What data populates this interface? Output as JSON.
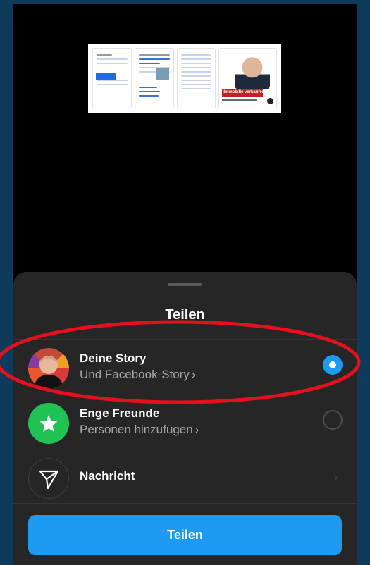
{
  "preview": {
    "ad_headline": "Immobilie verkaufen?"
  },
  "sheet": {
    "title": "Teilen",
    "options": [
      {
        "title": "Deine Story",
        "subtitle": "Und Facebook-Story",
        "selected": true,
        "icon": "avatar"
      },
      {
        "title": "Enge Freunde",
        "subtitle": "Personen hinzufügen",
        "selected": false,
        "icon": "star-icon"
      },
      {
        "title": "Nachricht",
        "subtitle": "",
        "selected": false,
        "icon": "paper-plane-icon"
      }
    ],
    "chevron": "›",
    "share_button": "Teilen"
  },
  "colors": {
    "accent": "#1d9bf0",
    "sheet_bg": "#262626",
    "close_friends_green": "#1fc253",
    "annotation_red": "#e5101d"
  }
}
